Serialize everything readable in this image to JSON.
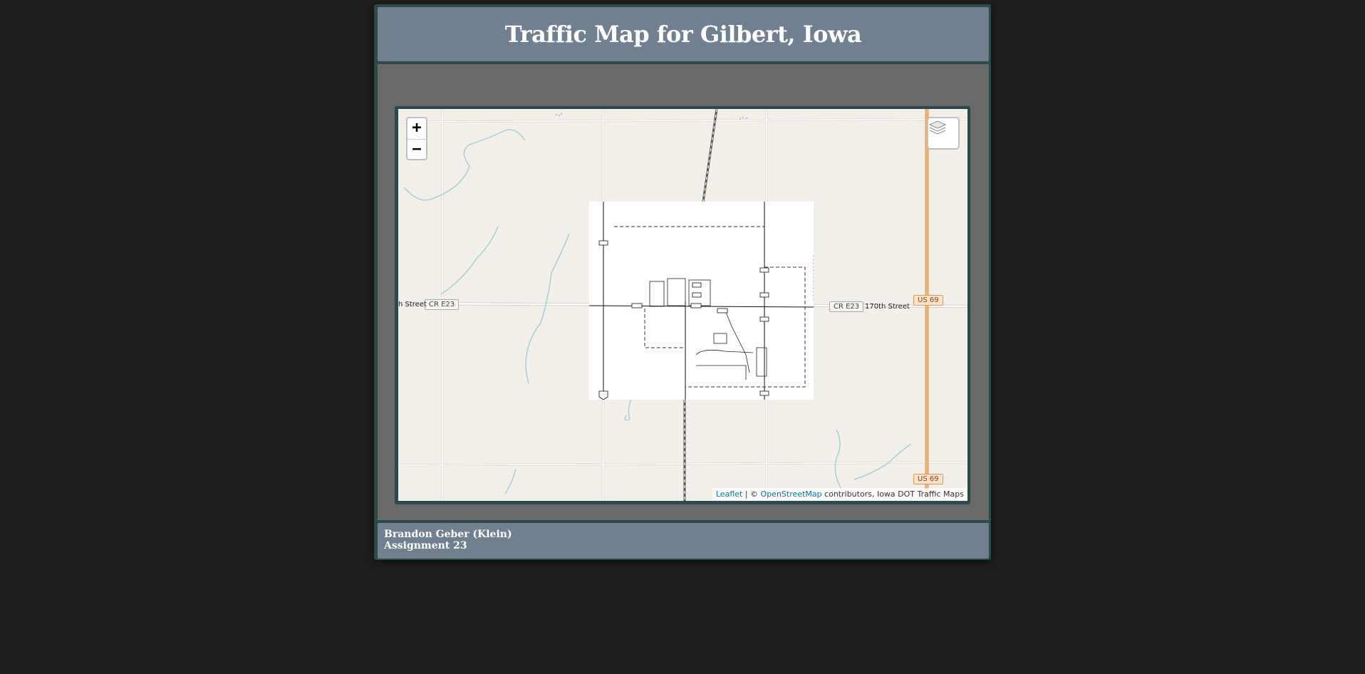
{
  "header": {
    "title": "Traffic Map for Gilbert, Iowa"
  },
  "map": {
    "zoom_in_label": "+",
    "zoom_out_label": "−",
    "layers_icon": "layers-icon",
    "road_labels": {
      "west_street": "h Street",
      "east_street": "170th Street",
      "cr_west": "CR E23",
      "cr_east": "CR E23",
      "us_upper": "US 69",
      "us_lower": "US 69"
    },
    "attribution": {
      "leaflet": "Leaflet",
      "separator": " | © ",
      "osm": "OpenStreetMap",
      "rest": " contributors, Iowa DOT Traffic Maps"
    },
    "colors": {
      "highway": "#f0b56e",
      "water": "#a0cfd6",
      "road": "#ffffff",
      "land": "#f2efe9"
    }
  },
  "footer": {
    "author": "Brandon Geber (Klein)",
    "assignment": "Assignment 23"
  }
}
